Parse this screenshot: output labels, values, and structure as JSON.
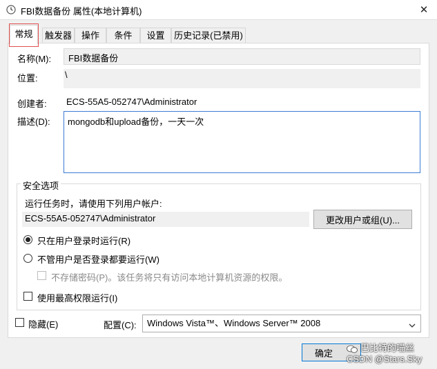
{
  "window": {
    "title": "FBI数据备份 属性(本地计算机)",
    "close_glyph": "✕"
  },
  "tabs": [
    {
      "label": "常规"
    },
    {
      "label": "触发器"
    },
    {
      "label": "操作"
    },
    {
      "label": "条件"
    },
    {
      "label": "设置"
    },
    {
      "label": "历史记录(已禁用)"
    }
  ],
  "general": {
    "name_label": "名称(M):",
    "name_value": "FBI数据备份",
    "location_label": "位置:",
    "location_value": "\\",
    "author_label": "创建者:",
    "author_value": "ECS-55A5-052747\\Administrator",
    "description_label": "描述(D):",
    "description_value": "mongodb和upload备份，一天一次"
  },
  "security": {
    "group_title": "安全选项",
    "run_as_prompt": "运行任务时，请使用下列用户帐户:",
    "account_value": "ECS-55A5-052747\\Administrator",
    "change_user_button": "更改用户或组(U)...",
    "radio_logged_on": "只在用户登录时运行(R)",
    "radio_any": "不管用户是否登录都要运行(W)",
    "no_store_password": "不存储密码(P)。该任务将只有访问本地计算机资源的权限。",
    "highest_privileges": "使用最高权限运行(I)"
  },
  "footer": {
    "hidden_label": "隐藏(E)",
    "configure_label": "配置(C):",
    "configure_value": "Windows Vista™、Windows Server™ 2008",
    "ok_button": "确定"
  },
  "watermark": {
    "line1": "巴比特的喵丝",
    "line2": "CSDN @Stars.Sky"
  }
}
